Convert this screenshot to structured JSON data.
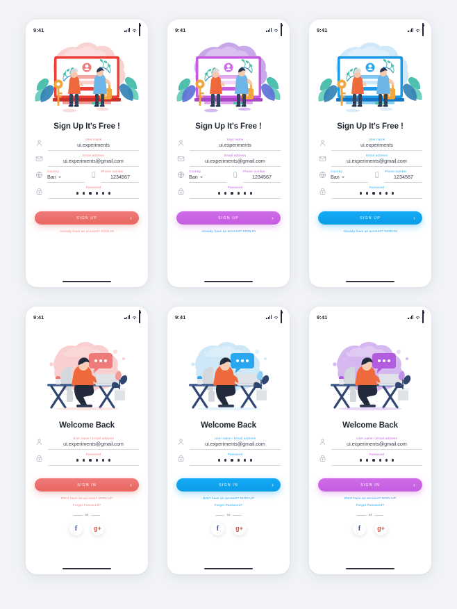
{
  "canvas": {
    "background": "#f1f3f6"
  },
  "statusbar": {
    "time": "9:41",
    "icons": [
      "signal-icon",
      "wifi-icon",
      "battery-icon"
    ]
  },
  "themes": {
    "coral": {
      "accent": "#ef7a7a",
      "accent_dark": "#e8675f",
      "label": "#f0827f",
      "link": "#f18a86",
      "glow": "rgba(239,122,122,0.40)"
    },
    "violet": {
      "accent": "#cf6ce7",
      "accent_dark": "#c45ce0",
      "label": "#c05fdd",
      "link": "#2aa7ee",
      "glow": "rgba(207,108,231,0.40)"
    },
    "blue": {
      "accent": "#14aaf5",
      "accent_dark": "#0d9ce8",
      "label": "#2ab0f0",
      "link": "#2aa7ee",
      "glow": "rgba(20,170,245,0.40)"
    }
  },
  "screens": [
    {
      "id": "signup-coral",
      "kind": "signup",
      "theme": "coral",
      "illustration": "signup-security-illustration",
      "title": "Sign Up It's Free !",
      "fields": [
        {
          "icon": "user-icon",
          "label": "User name",
          "value": "ui.experiments",
          "type": "text"
        },
        {
          "icon": "envelope-icon",
          "label": "Email address",
          "value": "ui.experiments@gmail.com",
          "type": "text"
        }
      ],
      "country": {
        "icon": "globe-icon",
        "label": "Country",
        "value": "Ban"
      },
      "phone": {
        "icon": "phone-icon",
        "label": "Phone number",
        "value": "1234567"
      },
      "password": {
        "icon": "lock-icon",
        "label": "Password",
        "dots": 6
      },
      "cta": {
        "label": "SIGN UP",
        "chevron": "chevron-right-icon"
      },
      "alt_link": "Already have an account? SIGN IN"
    },
    {
      "id": "signup-violet",
      "kind": "signup",
      "theme": "violet",
      "illustration": "signup-security-illustration",
      "title": "Sign Up It's Free !",
      "fields": [
        {
          "icon": "user-icon",
          "label": "User name",
          "value": "ui.experiments",
          "type": "text"
        },
        {
          "icon": "envelope-icon",
          "label": "Email address",
          "value": "ui.experiments@gmail.com",
          "type": "text"
        }
      ],
      "country": {
        "icon": "globe-icon",
        "label": "Country",
        "value": "Ban"
      },
      "phone": {
        "icon": "phone-icon",
        "label": "Phone number",
        "value": "1234567"
      },
      "password": {
        "icon": "lock-icon",
        "label": "Password",
        "dots": 6
      },
      "cta": {
        "label": "SIGN UP",
        "chevron": "chevron-right-icon"
      },
      "alt_link": "Already have an account? SIGN IN"
    },
    {
      "id": "signup-blue",
      "kind": "signup",
      "theme": "blue",
      "illustration": "signup-security-illustration",
      "title": "Sign Up It's Free !",
      "fields": [
        {
          "icon": "user-icon",
          "label": "User name",
          "value": "ui.experiments",
          "type": "text"
        },
        {
          "icon": "envelope-icon",
          "label": "Email address",
          "value": "ui.experiments@gmail.com",
          "type": "text"
        }
      ],
      "country": {
        "icon": "globe-icon",
        "label": "Country",
        "value": "Ban"
      },
      "phone": {
        "icon": "phone-icon",
        "label": "Phone number",
        "value": "1234567"
      },
      "password": {
        "icon": "lock-icon",
        "label": "Password",
        "dots": 6
      },
      "cta": {
        "label": "SIGN UP",
        "chevron": "chevron-right-icon"
      },
      "alt_link": "Already have an account? SIGN IN"
    },
    {
      "id": "signin-coral",
      "kind": "signin",
      "theme": "coral",
      "illustration": "desk-laptop-illustration",
      "title": "Welcome Back",
      "fields": [
        {
          "icon": "user-icon",
          "label": "User name / Email address",
          "value": "ui.experiments@gmail.com",
          "type": "text"
        }
      ],
      "password": {
        "icon": "lock-icon",
        "label": "Password",
        "dots": 6
      },
      "cta": {
        "label": "SIGN IN",
        "chevron": "chevron-right-icon"
      },
      "alt_link": "Don't have an account? SIGN UP",
      "forgot_link": "Forget Password?",
      "divider": "or",
      "socials": [
        {
          "name": "facebook-button",
          "glyph": "f"
        },
        {
          "name": "google-plus-button",
          "glyph": "g+"
        }
      ]
    },
    {
      "id": "signin-blue",
      "kind": "signin",
      "theme": "blue",
      "illustration": "desk-laptop-illustration",
      "title": "Welcome Back",
      "fields": [
        {
          "icon": "user-icon",
          "label": "User name / Email address",
          "value": "ui.experiments@gmail.com",
          "type": "text"
        }
      ],
      "password": {
        "icon": "lock-icon",
        "label": "Password",
        "dots": 6
      },
      "cta": {
        "label": "SIGN IN",
        "chevron": "chevron-right-icon"
      },
      "alt_link": "Don't have an account? SIGN UP",
      "forgot_link": "Forget Password?",
      "divider": "or",
      "socials": [
        {
          "name": "facebook-button",
          "glyph": "f"
        },
        {
          "name": "google-plus-button",
          "glyph": "g+"
        }
      ]
    },
    {
      "id": "signin-violet",
      "kind": "signin",
      "theme": "violet",
      "illustration": "desk-laptop-illustration",
      "title": "Welcome Back",
      "fields": [
        {
          "icon": "user-icon",
          "label": "User name / Email address",
          "value": "ui.experiments@gmail.com",
          "type": "text"
        }
      ],
      "password": {
        "icon": "lock-icon",
        "label": "Password",
        "dots": 6
      },
      "cta": {
        "label": "SIGN IN",
        "chevron": "chevron-right-icon"
      },
      "alt_link": "Don't have an account? SIGN UP",
      "forgot_link": "Forget Password?",
      "divider": "or",
      "socials": [
        {
          "name": "facebook-button",
          "glyph": "f"
        },
        {
          "name": "google-plus-button",
          "glyph": "g+"
        }
      ]
    }
  ]
}
